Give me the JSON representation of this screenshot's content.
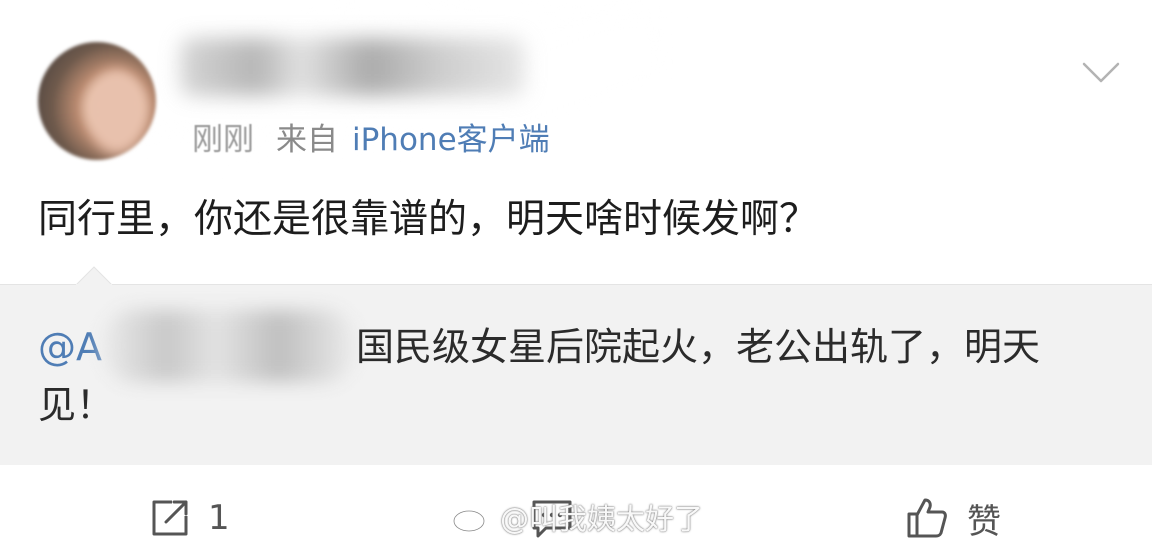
{
  "post": {
    "time": "刚刚",
    "from_label": "来自",
    "client": "iPhone客户端",
    "comment_text": "同行里，你还是很靠谱的，明天啥时候发啊？"
  },
  "quote": {
    "mention": "@A",
    "line1": "国民级女星后院起火，老公出轨了，明天",
    "line2": "见！"
  },
  "actions": {
    "forward_count": "1",
    "like_label": "赞"
  },
  "watermark": {
    "text": "@叫我姨太好了"
  },
  "colors": {
    "link_blue": "#4f7db5",
    "quote_bg": "#f2f2f2",
    "meta_gray": "#8a8a8a"
  },
  "icons": [
    "chevron-down-icon",
    "forward-icon",
    "comment-icon",
    "thumbs-up-icon",
    "weibo-logo-icon"
  ]
}
